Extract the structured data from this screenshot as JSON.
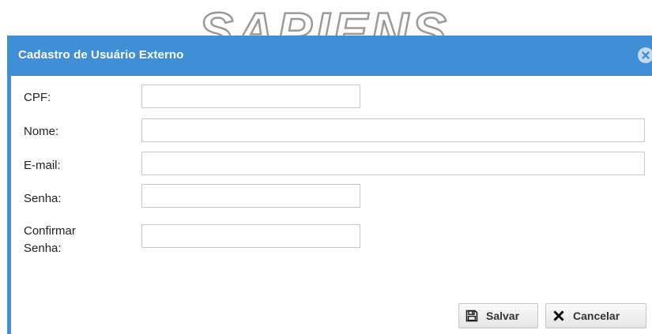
{
  "logo": {
    "text": "SAPIENS"
  },
  "dialog": {
    "title": "Cadastro de Usuário Externo",
    "close_icon": "close-circle-icon",
    "header_color": "#3e8fd6"
  },
  "form": {
    "cpf": {
      "label": "CPF:",
      "value": ""
    },
    "nome": {
      "label": "Nome:",
      "value": ""
    },
    "email": {
      "label": "E-mail:",
      "value": ""
    },
    "senha": {
      "label": "Senha:",
      "value": ""
    },
    "confirmar_senha": {
      "label_line1": "Confirmar",
      "label_line2": "Senha:",
      "value": ""
    }
  },
  "buttons": {
    "save": {
      "label": "Salvar",
      "icon": "floppy-disk-icon"
    },
    "cancel": {
      "label": "Cancelar",
      "icon": "x-icon"
    }
  }
}
